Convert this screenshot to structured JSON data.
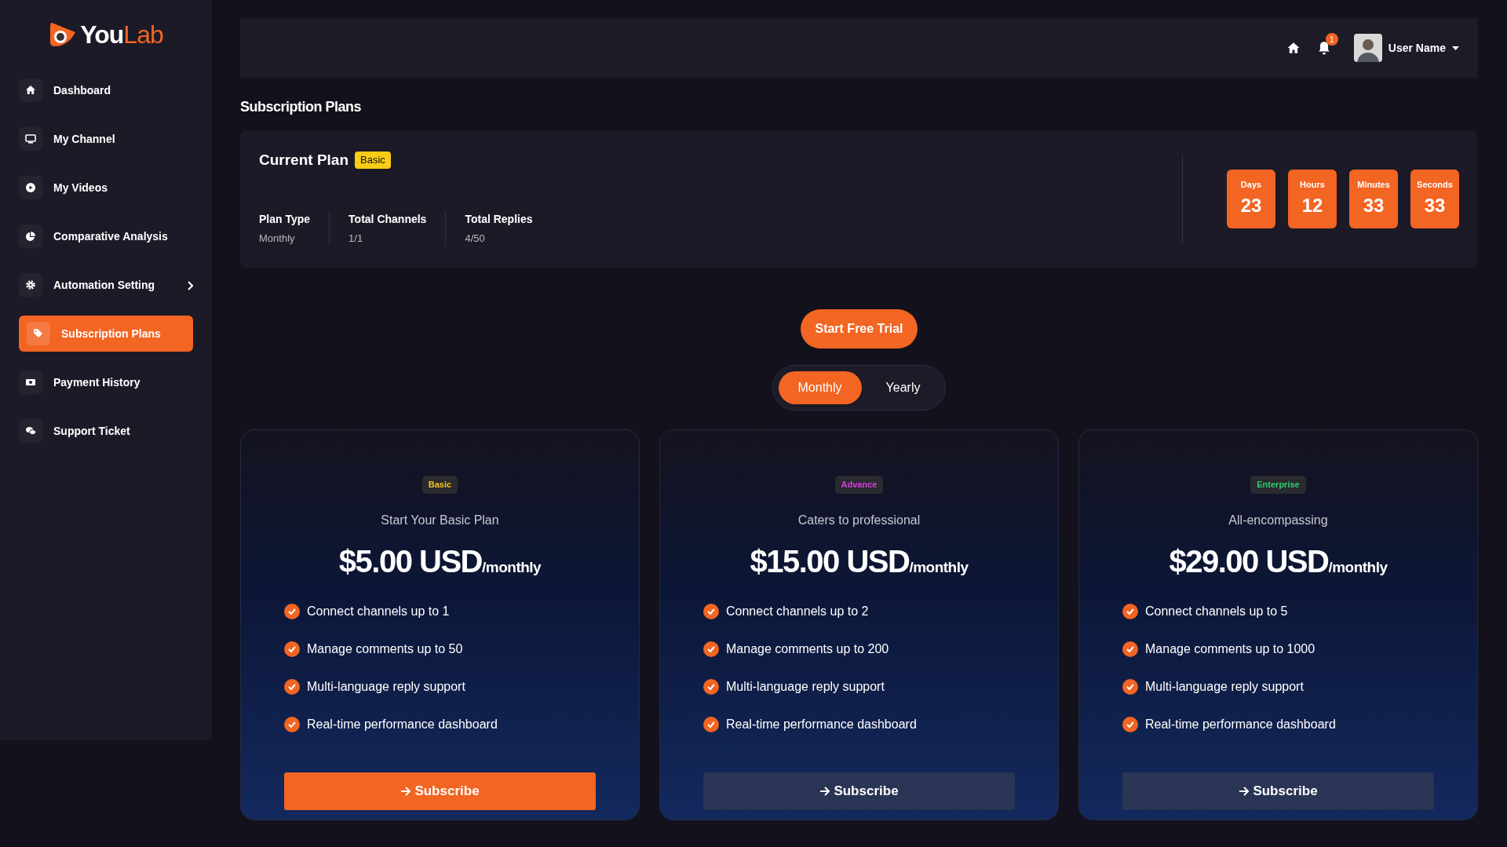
{
  "logo": {
    "part_1": "You",
    "part_2": "Lab"
  },
  "sidebar": {
    "items": [
      {
        "label": "Dashboard",
        "selected": false,
        "has_submenu": false
      },
      {
        "label": "My Channel",
        "selected": false,
        "has_submenu": false
      },
      {
        "label": "My Videos",
        "selected": false,
        "has_submenu": false
      },
      {
        "label": "Comparative Analysis",
        "selected": false,
        "has_submenu": false
      },
      {
        "label": "Automation Setting",
        "selected": false,
        "has_submenu": true
      },
      {
        "label": "Subscription Plans",
        "selected": true,
        "has_submenu": false
      },
      {
        "label": "Payment History",
        "selected": false,
        "has_submenu": false
      },
      {
        "label": "Support Ticket",
        "selected": false,
        "has_submenu": false
      }
    ]
  },
  "header": {
    "notification_count": "1",
    "user_name": "User Name"
  },
  "page_title": "Subscription Plans",
  "current_plan": {
    "title": "Current Plan",
    "badge": "Basic",
    "stats": [
      {
        "label": "Plan Type",
        "value": "Monthly"
      },
      {
        "label": "Total Channels",
        "value": "1/1"
      },
      {
        "label": "Total Replies",
        "value": "4/50"
      }
    ],
    "countdown": [
      {
        "label": "Days",
        "value": "23"
      },
      {
        "label": "Hours",
        "value": "12"
      },
      {
        "label": "Minutes",
        "value": "33"
      },
      {
        "label": "Seconds",
        "value": "33"
      }
    ]
  },
  "trial_button": "Start Free Trial",
  "billing_toggle": [
    {
      "label": "Monthly",
      "selected": true
    },
    {
      "label": "Yearly",
      "selected": false
    }
  ],
  "plans": [
    {
      "tag": "Basic",
      "color": "#f5c518",
      "subtitle": "Start Your Basic Plan",
      "price": "$5.00 USD",
      "period": "/monthly",
      "features": [
        "Connect channels up to 1",
        "Manage comments up to 50",
        "Multi-language reply support",
        "Real-time performance dashboard"
      ],
      "button": "Subscribe",
      "highlighted": true
    },
    {
      "tag": "Advance",
      "color": "#d63fe0",
      "subtitle": "Caters to professional",
      "price": "$15.00 USD",
      "period": "/monthly",
      "features": [
        "Connect channels up to 2",
        "Manage comments up to 200",
        "Multi-language reply support",
        "Real-time performance dashboard"
      ],
      "button": "Subscribe",
      "highlighted": false
    },
    {
      "tag": "Enterprise",
      "color": "#2ecc71",
      "subtitle": "All-encompassing",
      "price": "$29.00 USD",
      "period": "/monthly",
      "features": [
        "Connect channels up to 5",
        "Manage comments up to 1000",
        "Multi-language reply support",
        "Real-time performance dashboard"
      ],
      "button": "Subscribe",
      "highlighted": false
    }
  ]
}
